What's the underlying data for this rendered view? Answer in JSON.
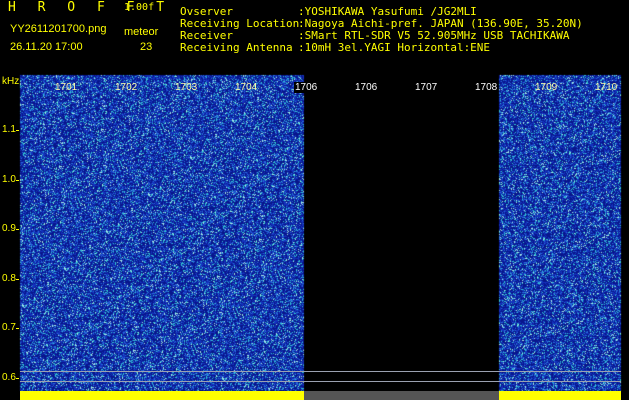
{
  "header": {
    "app_title": "H R O F F T",
    "version": "1.00f",
    "file_name": "YY2611201700.png",
    "mode": "meteor",
    "date_time": "26.11.20 17:00",
    "meteor_count": "23"
  },
  "info": [
    {
      "key": "Ovserver",
      "value": ":YOSHIKAWA Yasufumi /JG2MLI"
    },
    {
      "key": "Receiving Location",
      "value": ":Nagoya Aichi-pref. JAPAN (136.90E, 35.20N)"
    },
    {
      "key": "Receiver",
      "value": ":SMart RTL-SDR V5 52.905MHz USB TACHIKAWA"
    },
    {
      "key": "Receiving Antenna",
      "value": ":10mH 3el.YAGI Horizontal:ENE"
    }
  ],
  "y_axis": {
    "unit": "kHz",
    "ticks": [
      "1.1",
      "1.0",
      "0.9",
      "0.8",
      "0.7",
      "0.6"
    ]
  },
  "x_axis": {
    "labels": [
      "1701",
      "1702",
      "1703",
      "1704",
      "1706",
      "1706",
      "1707",
      "1708",
      "1709",
      "1710"
    ]
  },
  "colors": {
    "accent": "#ffff00",
    "spectrum_low": "#0a1a9a",
    "spectrum_high": "#30e0d0",
    "gap": "#000000"
  }
}
